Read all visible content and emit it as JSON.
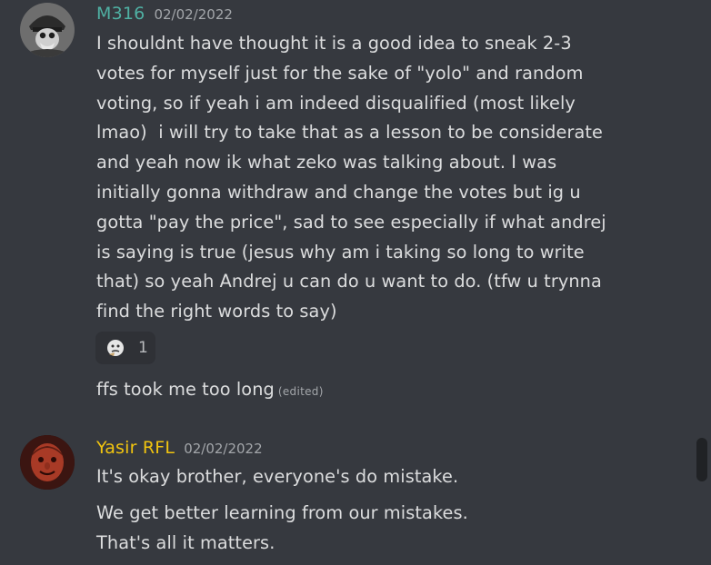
{
  "colors": {
    "background": "#36393f",
    "message_text": "#dcddde",
    "timestamp": "#a3a6aa",
    "user1_name": "#4fb0a3",
    "user2_name": "#f1c40f",
    "reaction_bg": "#2f3136",
    "scrollbar_thumb": "#202225"
  },
  "messages": [
    {
      "author": "M316",
      "timestamp": "02/02/2022",
      "avatar_icon": "helmet-soldier-avatar",
      "text": "I shouldnt have thought it is a good idea to sneak 2-3\nvotes for myself just for the sake of \"yolo\" and random\nvoting, so if yeah i am indeed disqualified (most likely\nlmao)  i will try to take that as a lesson to be considerate\nand yeah now ik what zeko was talking about. I was\ninitially gonna withdraw and change the votes but ig u\ngotta \"pay the price\", sad to see especially if what andrej\nis saying is true (jesus why am i taking so long to write\nthat) so yeah Andrej u can do u want to do. (tfw u trynna\nfind the right words to say)",
      "reaction": {
        "emoji_icon": "thinking-face-emoji",
        "count": "1"
      },
      "followup_text": "ffs took me too long",
      "edited_label": "(edited)"
    },
    {
      "author": "Yasir RFL",
      "timestamp": "02/02/2022",
      "avatar_icon": "red-face-avatar",
      "text": "It's okay brother, everyone's do mistake.",
      "followup_text": "We get better learning from our mistakes.\nThat's all it matters."
    }
  ]
}
